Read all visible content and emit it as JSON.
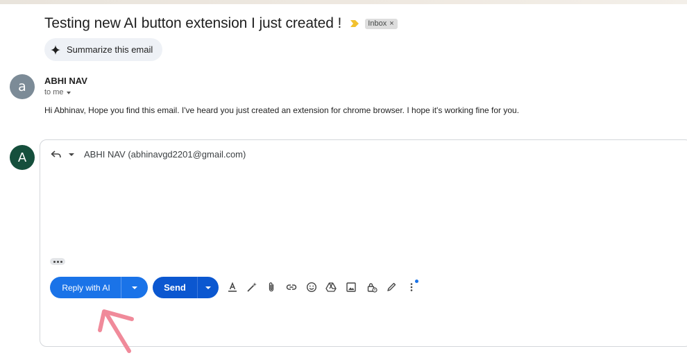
{
  "email": {
    "subject": "Testing new AI button extension I just created !",
    "label": "Inbox",
    "label_close": "×",
    "summarize_label": "Summarize this email"
  },
  "message": {
    "avatar_letter": "a",
    "sender": "ABHI NAV",
    "to": "to me",
    "body": "Hi Abhinav, Hope you find this email. I've heard you just created an extension for chrome browser. I hope it's working fine for you."
  },
  "reply": {
    "avatar_letter": "A",
    "recipient": "ABHI NAV (abhinavgd2201@gmail.com)",
    "reply_ai_label": "Reply with AI",
    "send_label": "Send"
  },
  "toolbar": {
    "icons": [
      "formatting-icon",
      "ai-write-icon",
      "attach-icon",
      "link-icon",
      "emoji-icon",
      "drive-icon",
      "photo-icon",
      "confidential-icon",
      "signature-icon",
      "more-options-icon"
    ]
  },
  "colors": {
    "reply_ai_button": "#1a73e8",
    "send_button": "#0b57d0",
    "reply_avatar": "#154f3c",
    "sender_avatar": "#7c8b97",
    "importance_marker": "#f2c12e",
    "annotation_arrow": "#f08a9a"
  }
}
